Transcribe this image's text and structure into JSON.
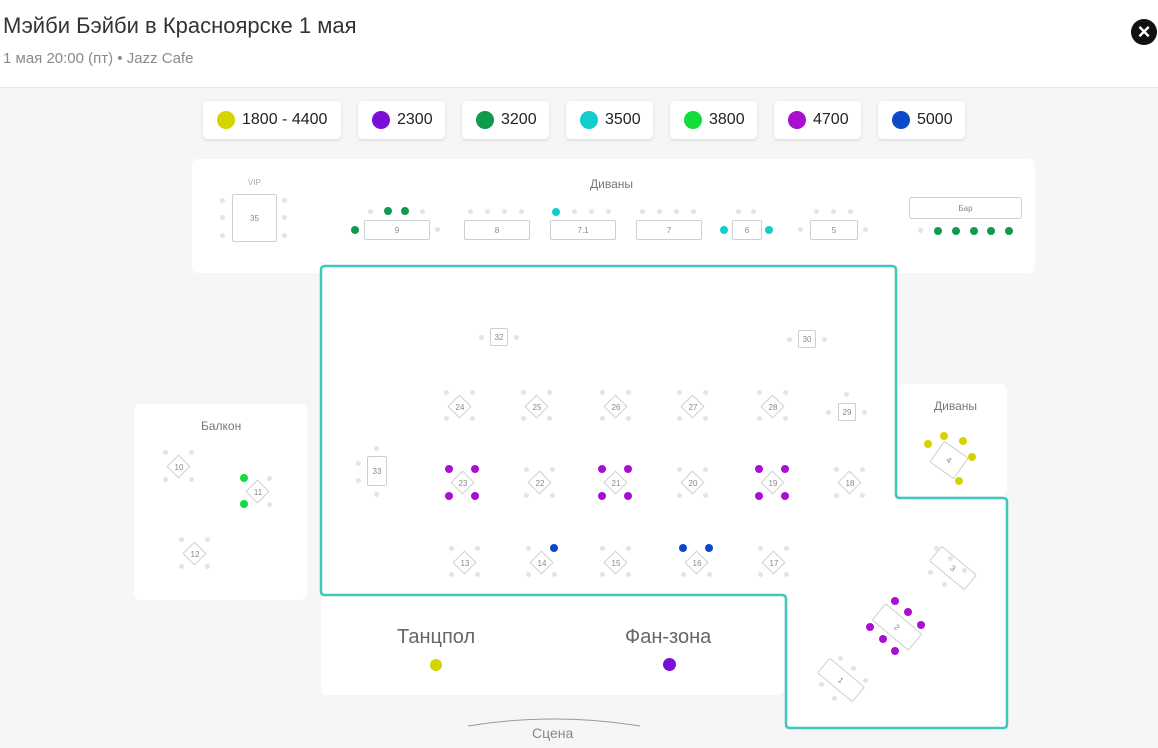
{
  "header": {
    "title": "Мэйби Бэйби в Красноярске 1 мая",
    "subtitle": "1 мая 20:00 (пт) • Jazz Cafe",
    "close_icon": "close-icon"
  },
  "legend": [
    {
      "label": "1800 - 4400",
      "color": "#d4d400"
    },
    {
      "label": "2300",
      "color": "#7b0fd8"
    },
    {
      "label": "3200",
      "color": "#0f9a4c"
    },
    {
      "label": "3500",
      "color": "#13cccc"
    },
    {
      "label": "3800",
      "color": "#12dc3c"
    },
    {
      "label": "4700",
      "color": "#a80fd0"
    },
    {
      "label": "5000",
      "color": "#0b49c8"
    }
  ],
  "zones": {
    "sofas_top": "Диваны",
    "vip": "VIP",
    "bar": "Бар",
    "sofas_right": "Диваны",
    "balcony": "Балкон",
    "dance_floor": "Танцпол",
    "fan_zone": "Фан-зона",
    "stage": "Сцена"
  },
  "tables": {
    "t35": "35",
    "t9": "9",
    "t8": "8",
    "t71": "7.1",
    "t7": "7",
    "t6": "6",
    "t5": "5",
    "t32": "32",
    "t30": "30",
    "t33": "33",
    "t29": "29",
    "t4": "4",
    "t3": "3",
    "t2": "2",
    "t1": "1",
    "t10": "10",
    "t11": "11",
    "t12": "12",
    "t24": "24",
    "t25": "25",
    "t26": "26",
    "t27": "27",
    "t28": "28",
    "t23": "23",
    "t22": "22",
    "t21": "21",
    "t20": "20",
    "t19": "19",
    "t18": "18",
    "t13": "13",
    "t14": "14",
    "t15": "15",
    "t16": "16",
    "t17": "17"
  }
}
